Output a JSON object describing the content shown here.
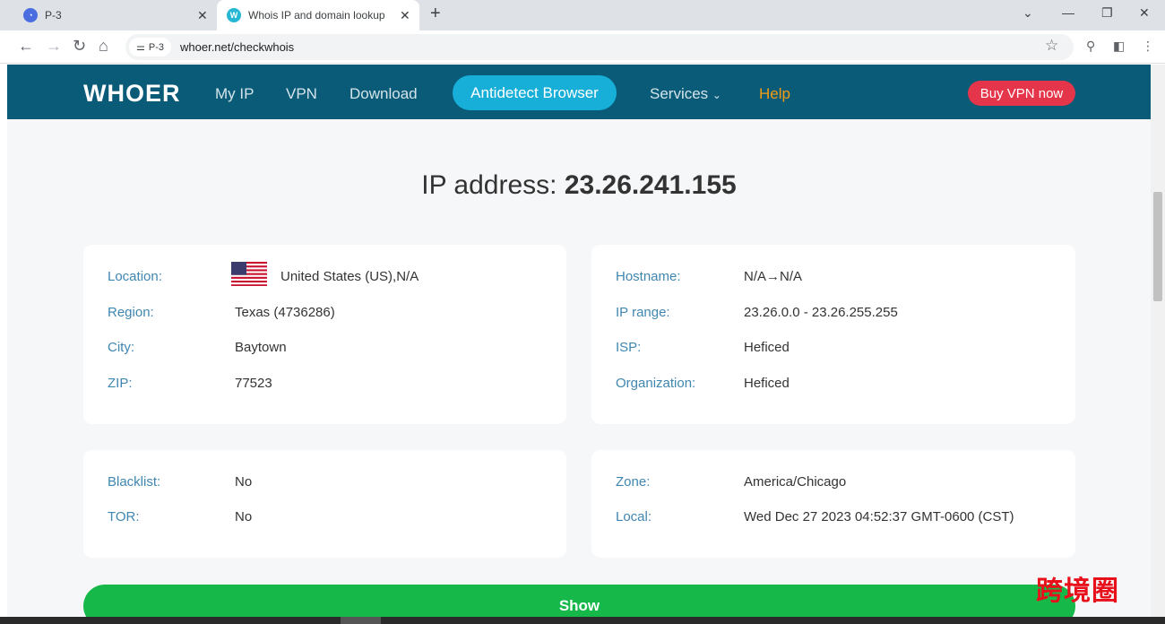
{
  "browser": {
    "tabs": [
      {
        "title": "P-3",
        "favicon": "app-logo-icon",
        "active": false
      },
      {
        "title": "Whois IP and domain lookup",
        "favicon": "whoer-w-icon",
        "active": true
      }
    ],
    "new_tab_symbol": "+",
    "profile_chip": "P-3",
    "url": "whoer.net/checkwhois"
  },
  "site": {
    "logo": "WHOER",
    "nav": {
      "my_ip": "My IP",
      "vpn": "VPN",
      "download": "Download",
      "antidetect": "Antidetect Browser",
      "services": "Services",
      "help": "Help"
    },
    "buy_vpn": "Buy VPN now"
  },
  "ip": {
    "label": "IP address:",
    "value": "23.26.241.155"
  },
  "location_card": {
    "location_label": "Location:",
    "location_value": "United States (US),N/A",
    "region_label": "Region:",
    "region_value": "Texas (4736286)",
    "city_label": "City:",
    "city_value": "Baytown",
    "zip_label": "ZIP:",
    "zip_value": "77523"
  },
  "network_card": {
    "hostname_label": "Hostname:",
    "hostname_value": "N/A→N/A",
    "range_label": "IP range:",
    "range_value": "23.26.0.0 - 23.26.255.255",
    "isp_label": "ISP:",
    "isp_value": "Heficed",
    "org_label": "Organization:",
    "org_value": "Heficed"
  },
  "status_card": {
    "blacklist_label": "Blacklist:",
    "blacklist_value": "No",
    "tor_label": "TOR:",
    "tor_value": "No"
  },
  "time_card": {
    "zone_label": "Zone:",
    "zone_value": "America/Chicago",
    "local_label": "Local:",
    "local_value": "Wed Dec 27 2023 04:52:37 GMT-0600 (CST)"
  },
  "show_button": "Show",
  "watermark": "跨境圈",
  "colors": {
    "header_bg": "#0a5b78",
    "accent_pill": "#17aed7",
    "buy_button": "#e5354b",
    "show_button": "#17b84a",
    "label_color": "#3f86b0",
    "help_link": "#f39c12"
  }
}
